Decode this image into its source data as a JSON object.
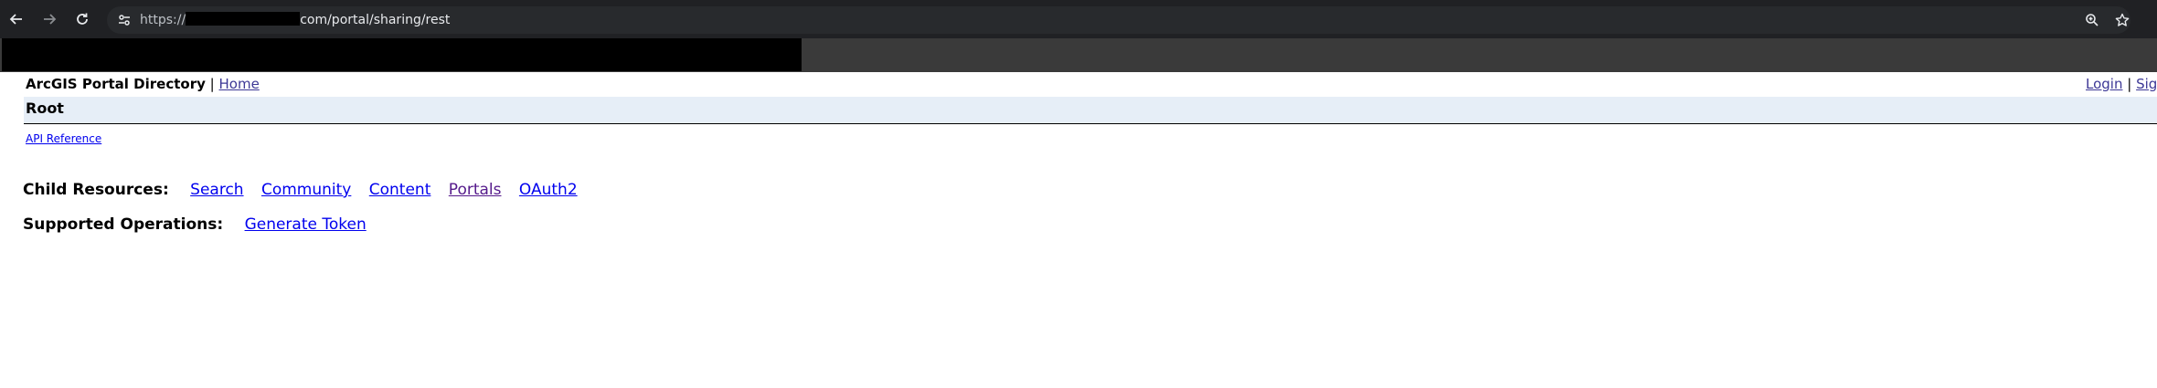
{
  "browser": {
    "url_prefix": "https://",
    "url_suffix": "com/portal/sharing/rest"
  },
  "header": {
    "directory_title": "ArcGIS Portal Directory",
    "separator": "|",
    "home_link": "Home",
    "login_link": "Login",
    "signup_link": "Sig"
  },
  "page": {
    "title": "Root",
    "api_reference": "API Reference",
    "child_resources_label": "Child Resources:",
    "child_resources": [
      "Search",
      "Community",
      "Content",
      "Portals",
      "OAuth2"
    ],
    "supported_operations_label": "Supported Operations:",
    "supported_operations": [
      "Generate Token"
    ]
  },
  "colors": {
    "link": "#0000ee",
    "visited_link": "#551a8b",
    "root_bar_bg": "#e6eef7",
    "chrome_bg": "#202124"
  },
  "icons": {
    "back": "arrow-left",
    "forward": "arrow-right",
    "reload": "reload",
    "site_info": "tune",
    "zoom": "zoom-in",
    "bookmark": "star"
  }
}
